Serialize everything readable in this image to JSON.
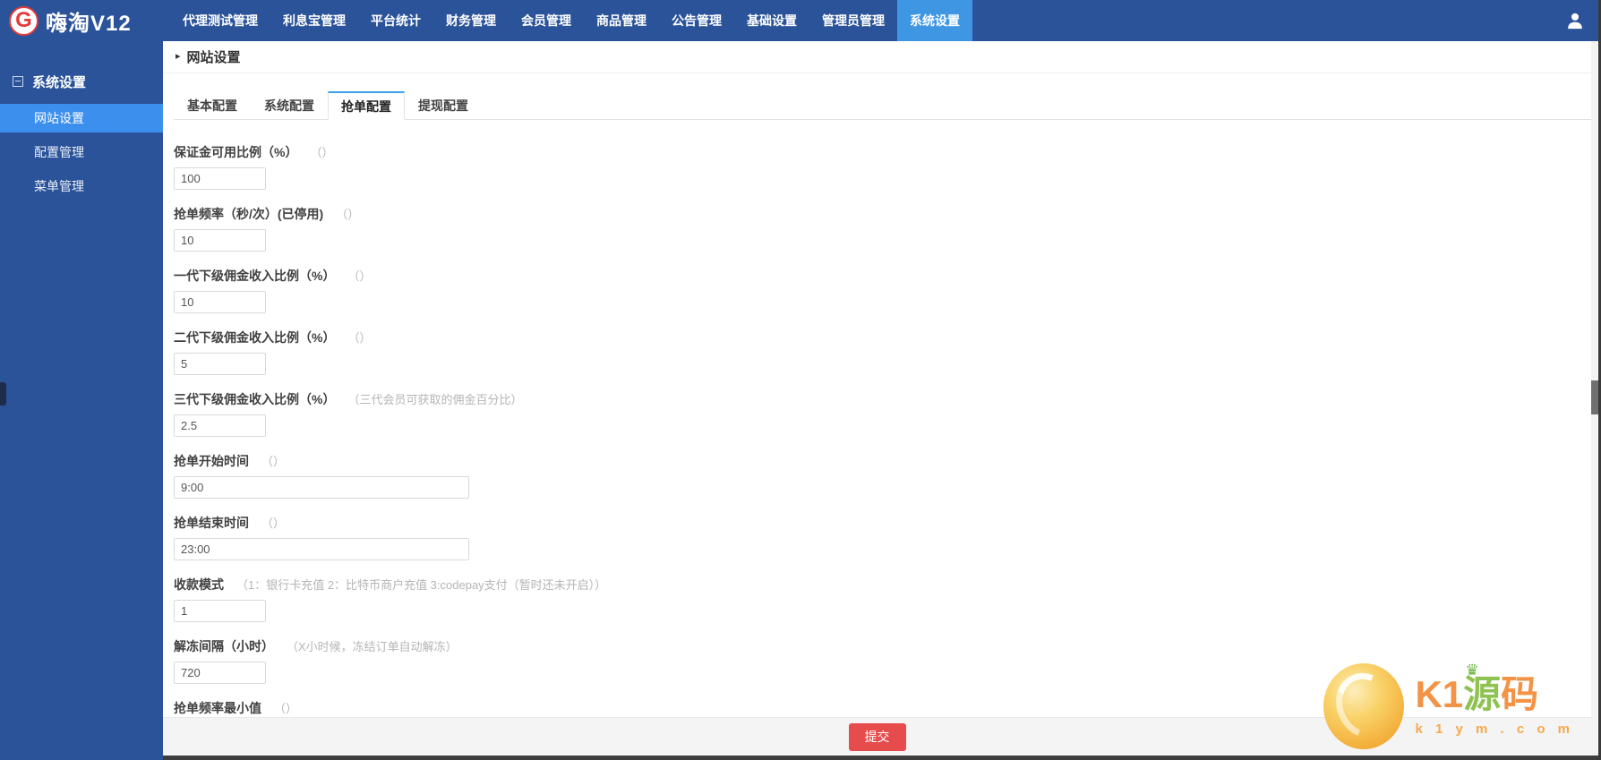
{
  "navbar": {
    "logo_letter": "G",
    "logo_title": "嗨淘V12",
    "items": [
      "代理测试管理",
      "利息宝管理",
      "平台统计",
      "财务管理",
      "会员管理",
      "商品管理",
      "公告管理",
      "基础设置",
      "管理员管理",
      "系统设置"
    ],
    "active_item": "系统设置"
  },
  "sidebar": {
    "group_label": "系统设置",
    "items": [
      "网站设置",
      "配置管理",
      "菜单管理"
    ],
    "selected_item": "网站设置"
  },
  "main": {
    "breadcrumb_arrow": "▸",
    "breadcrumb": "网站设置",
    "tabs": [
      "基本配置",
      "系统配置",
      "抢单配置",
      "提现配置"
    ],
    "active_tab": "抢单配置",
    "submit_label": "提交"
  },
  "form": {
    "fields": [
      {
        "label": "保证金可用比例（%）",
        "hint": "（）",
        "value": "100",
        "width": "small"
      },
      {
        "label": "抢单频率（秒/次）(已停用)",
        "hint": "（）",
        "value": "10",
        "width": "small"
      },
      {
        "label": "一代下级佣金收入比例（%）",
        "hint": "（）",
        "value": "10",
        "width": "small"
      },
      {
        "label": "二代下级佣金收入比例（%）",
        "hint": "（）",
        "value": "5",
        "width": "small"
      },
      {
        "label": "三代下级佣金收入比例（%）",
        "hint": "（三代会员可获取的佣金百分比）",
        "value": "2.5",
        "width": "small"
      },
      {
        "label": "抢单开始时间",
        "hint": "（）",
        "value": "9:00",
        "width": "wide"
      },
      {
        "label": "抢单结束时间",
        "hint": "（）",
        "value": "23:00",
        "width": "wide"
      },
      {
        "label": "收款模式",
        "hint": "（1：银行卡充值 2：比特币商户充值 3:codepay支付（暂时还未开启））",
        "value": "1",
        "width": "small"
      },
      {
        "label": "解冻间隔（小时）",
        "hint": "（X小时候，冻结订单自动解冻）",
        "value": "720",
        "width": "small"
      },
      {
        "label": "抢单频率最小值",
        "hint": "（）",
        "value": "",
        "width": "small"
      }
    ]
  },
  "watermark": {
    "k1": "K1",
    "yuan": "源",
    "ma": "码",
    "crown": "♛",
    "domain": "k 1 y m . c o m"
  },
  "colors": {
    "navbar_bg": "#2b5399",
    "nav_active_bg": "#3f97e4",
    "sidebar_selected_bg": "#3d8fee",
    "tab_accent": "#3ba0e8",
    "submit_red": "#e64c4c"
  }
}
